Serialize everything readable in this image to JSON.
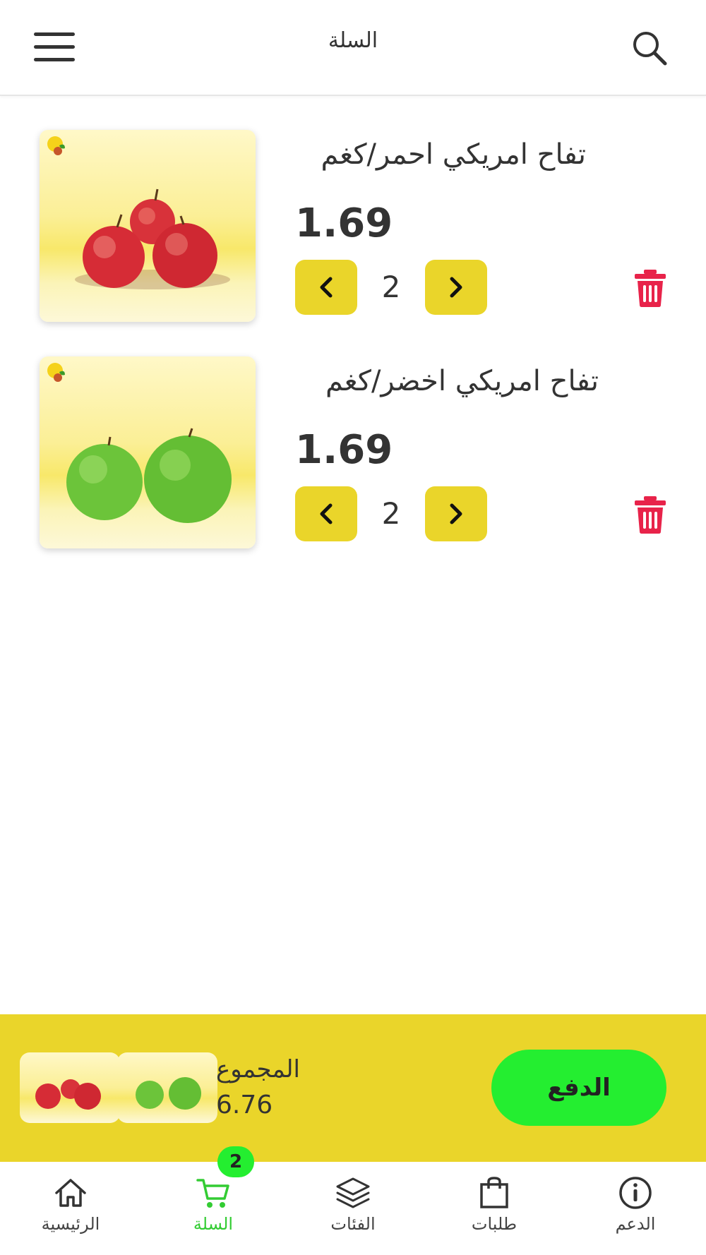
{
  "header": {
    "title": "السلة",
    "search_icon": "search-icon",
    "menu_icon": "hamburger-menu-icon"
  },
  "cart": {
    "items": [
      {
        "name": "تفاح امريكي احمر/كغم",
        "price": "1.69",
        "quantity": "2",
        "image": "red-apples",
        "decrement_icon": "chevron-left-icon",
        "increment_icon": "chevron-right-icon",
        "delete_icon": "trash-icon"
      },
      {
        "name": "تفاح امريكي اخضر/كغم",
        "price": "1.69",
        "quantity": "2",
        "image": "green-apples",
        "decrement_icon": "chevron-left-icon",
        "increment_icon": "chevron-right-icon",
        "delete_icon": "trash-icon"
      }
    ]
  },
  "checkout": {
    "total_label": "المجموع",
    "total_value": "6.76",
    "pay_label": "الدفع"
  },
  "bottom_nav": {
    "cart_badge": "2",
    "items": [
      {
        "label": "الرئيسية",
        "icon": "home-icon",
        "active": false
      },
      {
        "label": "السلة",
        "icon": "cart-icon",
        "active": true
      },
      {
        "label": "الفئات",
        "icon": "layers-icon",
        "active": false
      },
      {
        "label": "طلبات",
        "icon": "shopping-bag-icon",
        "active": false
      },
      {
        "label": "الدعم",
        "icon": "info-icon",
        "active": false
      }
    ]
  },
  "colors": {
    "accent_yellow": "#ead52a",
    "pay_green": "#24ee30",
    "active_nav_green": "#33cc33",
    "delete_red": "#e8234a"
  }
}
